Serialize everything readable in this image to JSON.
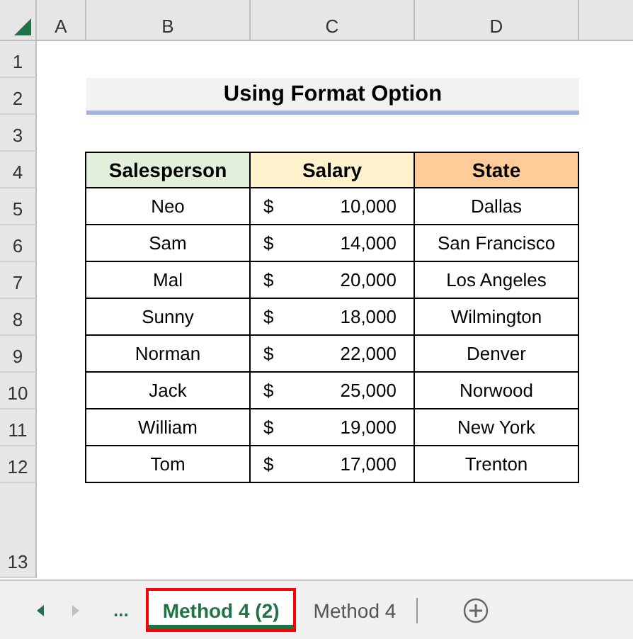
{
  "column_headers": [
    "A",
    "B",
    "C",
    "D"
  ],
  "row_headers": [
    "1",
    "2",
    "3",
    "4",
    "5",
    "6",
    "7",
    "8",
    "9",
    "10",
    "11",
    "12",
    "13"
  ],
  "title": "Using Format Option",
  "table": {
    "columns": [
      {
        "label": "Salesperson",
        "color": "#e2efda"
      },
      {
        "label": "Salary",
        "color": "#fff2cc"
      },
      {
        "label": "State",
        "color": "#ffcc99"
      }
    ],
    "rows": [
      {
        "salesperson": "Neo",
        "currency": "$",
        "salary": "10,000",
        "state": "Dallas"
      },
      {
        "salesperson": "Sam",
        "currency": "$",
        "salary": "14,000",
        "state": "San Francisco"
      },
      {
        "salesperson": "Mal",
        "currency": "$",
        "salary": "20,000",
        "state": "Los Angeles"
      },
      {
        "salesperson": "Sunny",
        "currency": "$",
        "salary": "18,000",
        "state": "Wilmington"
      },
      {
        "salesperson": "Norman",
        "currency": "$",
        "salary": "22,000",
        "state": "Denver"
      },
      {
        "salesperson": "Jack",
        "currency": "$",
        "salary": "25,000",
        "state": "Norwood"
      },
      {
        "salesperson": "William",
        "currency": "$",
        "salary": "19,000",
        "state": "New York"
      },
      {
        "salesperson": "Tom",
        "currency": "$",
        "salary": "17,000",
        "state": "Trenton"
      }
    ]
  },
  "sheet_tabs": {
    "overflow": "...",
    "tabs": [
      {
        "label": "Method 4 (2)",
        "selected": true,
        "highlighted": true
      },
      {
        "label": "Method 4",
        "selected": false,
        "highlighted": false
      }
    ]
  }
}
